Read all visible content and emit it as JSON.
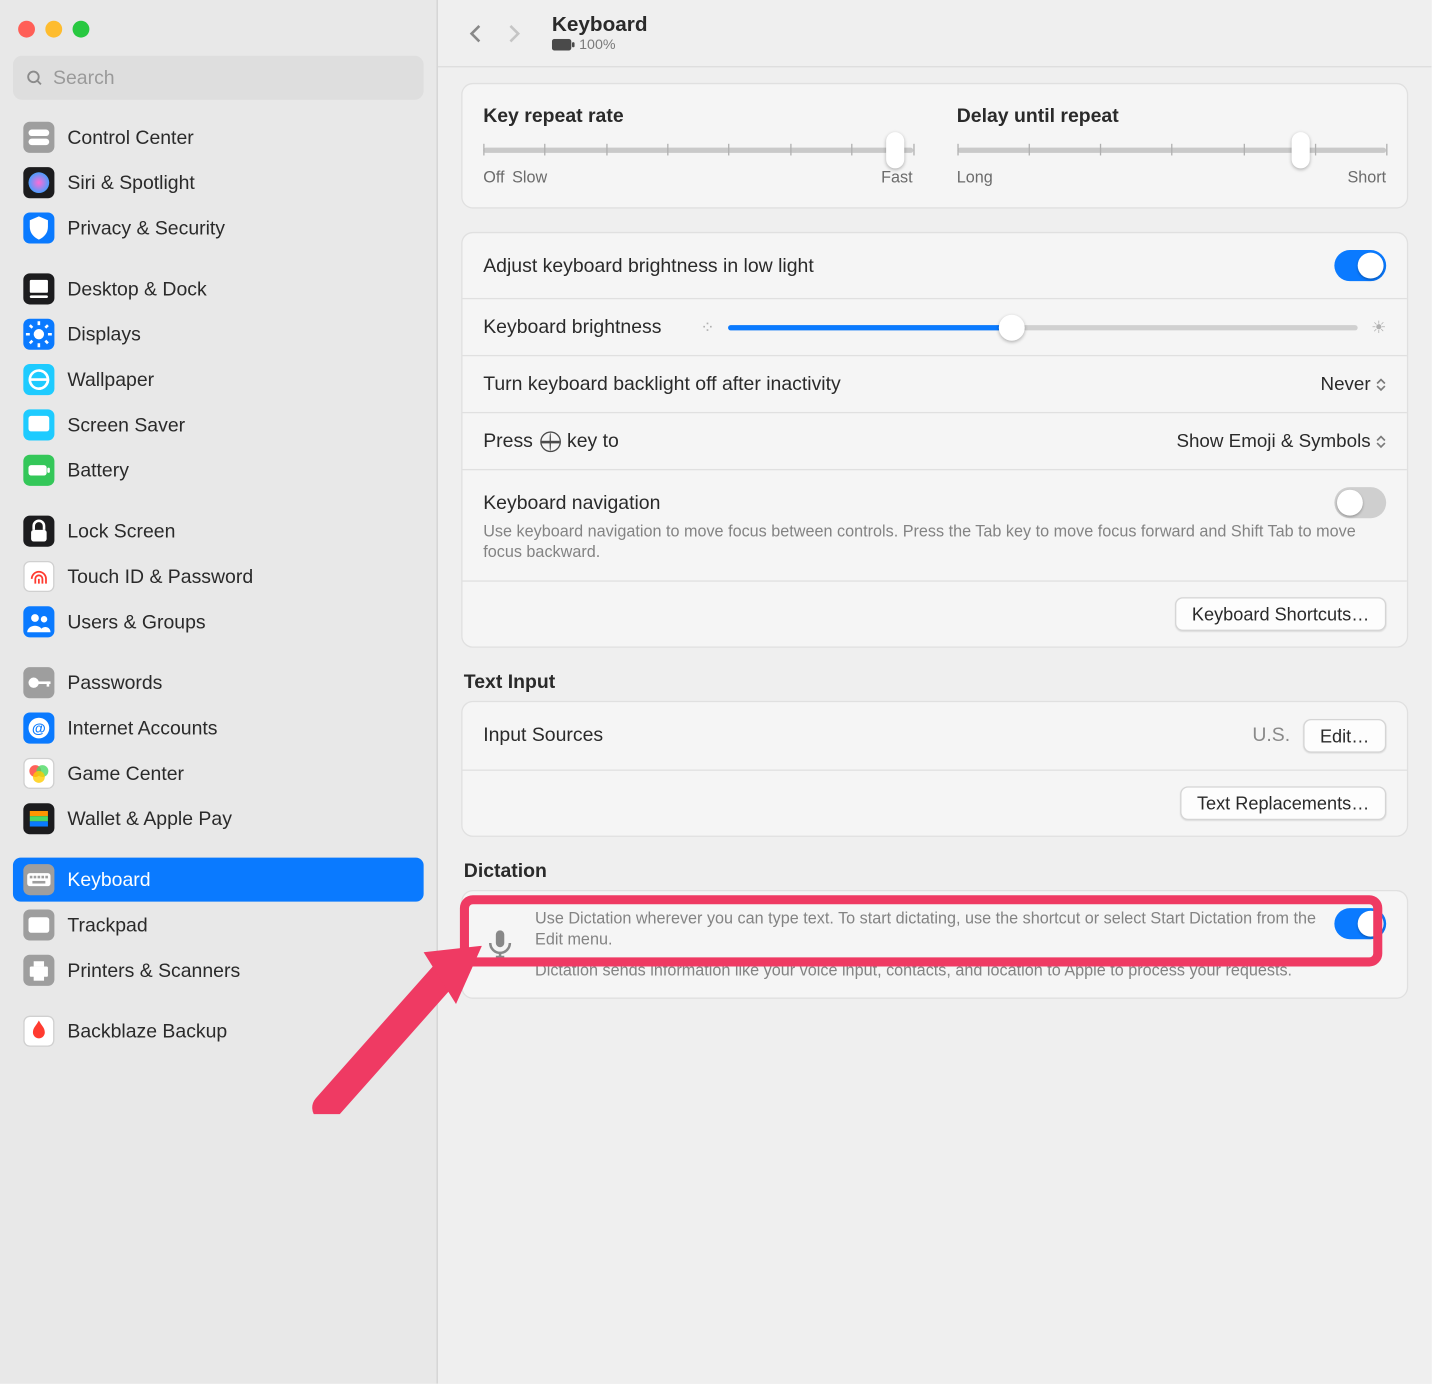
{
  "window": {
    "title": "Keyboard",
    "battery": "100%"
  },
  "sidebar": {
    "search_placeholder": "Search",
    "items": [
      {
        "label": "Control Center",
        "icon": "control-center",
        "bg": "#9e9e9e"
      },
      {
        "label": "Siri & Spotlight",
        "icon": "siri",
        "bg": "#1c1c1e"
      },
      {
        "label": "Privacy & Security",
        "icon": "privacy",
        "bg": "#0a7aff"
      },
      {
        "spacer": true
      },
      {
        "label": "Desktop & Dock",
        "icon": "dock",
        "bg": "#1c1c1e"
      },
      {
        "label": "Displays",
        "icon": "displays",
        "bg": "#0a7aff"
      },
      {
        "label": "Wallpaper",
        "icon": "wallpaper",
        "bg": "#1ecbff"
      },
      {
        "label": "Screen Saver",
        "icon": "screensaver",
        "bg": "#1ecbff"
      },
      {
        "label": "Battery",
        "icon": "battery",
        "bg": "#34c759"
      },
      {
        "spacer": true
      },
      {
        "label": "Lock Screen",
        "icon": "lockscreen",
        "bg": "#1c1c1e"
      },
      {
        "label": "Touch ID & Password",
        "icon": "touchid",
        "bg": "#ffffff"
      },
      {
        "label": "Users & Groups",
        "icon": "users",
        "bg": "#0a7aff"
      },
      {
        "spacer": true
      },
      {
        "label": "Passwords",
        "icon": "passwords",
        "bg": "#9e9e9e"
      },
      {
        "label": "Internet Accounts",
        "icon": "internet",
        "bg": "#0a7aff"
      },
      {
        "label": "Game Center",
        "icon": "gamecenter",
        "bg": "#ffffff"
      },
      {
        "label": "Wallet & Apple Pay",
        "icon": "wallet",
        "bg": "#1c1c1e"
      },
      {
        "spacer": true
      },
      {
        "label": "Keyboard",
        "icon": "keyboard",
        "bg": "#9e9e9e",
        "selected": true
      },
      {
        "label": "Trackpad",
        "icon": "trackpad",
        "bg": "#9e9e9e"
      },
      {
        "label": "Printers & Scanners",
        "icon": "printers",
        "bg": "#9e9e9e"
      },
      {
        "spacer": true
      },
      {
        "label": "Backblaze Backup",
        "icon": "backblaze",
        "bg": "#ffffff"
      }
    ]
  },
  "sliders": {
    "repeat_title": "Key repeat rate",
    "repeat_left": "Off",
    "repeat_mid": "Slow",
    "repeat_right": "Fast",
    "delay_title": "Delay until repeat",
    "delay_left": "Long",
    "delay_right": "Short"
  },
  "rows": {
    "adjust_brightness": "Adjust keyboard brightness in low light",
    "keyboard_brightness": "Keyboard brightness",
    "backlight_off": "Turn keyboard backlight off after inactivity",
    "backlight_value": "Never",
    "press_key": "Press 🌐 key to",
    "press_key_value": "Show Emoji & Symbols",
    "nav_title": "Keyboard navigation",
    "nav_desc": "Use keyboard navigation to move focus between controls. Press the Tab key to move focus forward and Shift Tab to move focus backward.",
    "shortcuts_btn": "Keyboard Shortcuts…"
  },
  "text_input": {
    "section": "Text Input",
    "input_sources": "Input Sources",
    "input_sources_value": "U.S.",
    "edit_btn": "Edit…",
    "replacements_btn": "Text Replacements…"
  },
  "dictation": {
    "section": "Dictation",
    "desc1": "Use Dictation wherever you can type text. To start dictating, use the shortcut or select Start Dictation from the Edit menu.",
    "desc2": "Dictation sends information like your voice input, contacts, and location to Apple to process your requests."
  }
}
